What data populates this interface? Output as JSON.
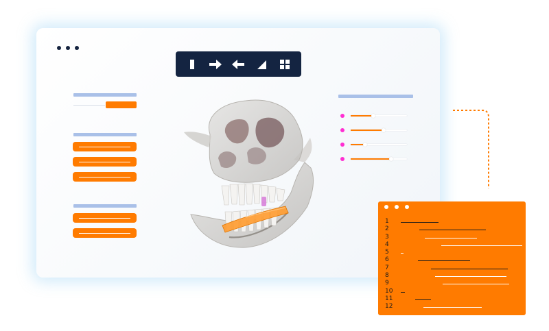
{
  "app": {
    "main_window": {
      "toolbar": {
        "tools": [
          {
            "id": "tool-select",
            "icon": "bar-icon"
          },
          {
            "id": "tool-right",
            "icon": "arrow-right-icon"
          },
          {
            "id": "tool-left",
            "icon": "arrow-left-icon"
          },
          {
            "id": "tool-angle",
            "icon": "triangle-icon"
          },
          {
            "id": "tool-grid",
            "icon": "grid-icon"
          }
        ]
      },
      "right_panel": {
        "sliders": [
          {
            "name": "slider-1",
            "value_fraction": 0.4
          },
          {
            "name": "slider-2",
            "value_fraction": 0.58
          },
          {
            "name": "slider-3",
            "value_fraction": 0.25
          },
          {
            "name": "slider-4",
            "value_fraction": 0.72
          }
        ]
      },
      "viewport": {
        "model": "3D skull model"
      }
    },
    "code_window": {
      "lines": [
        {
          "num": "1",
          "indent": 0.07,
          "length": 0.29,
          "color": "#1b1b1b"
        },
        {
          "num": "2",
          "indent": 0.21,
          "length": 0.51,
          "color": "#1b1b1b"
        },
        {
          "num": "3",
          "indent": 0.25,
          "length": 0.4,
          "color": "#ffffff"
        },
        {
          "num": "4",
          "indent": 0.38,
          "length": 0.62,
          "color": "#ffffff"
        },
        {
          "num": "5",
          "indent": 0.07,
          "length": 0.02,
          "color": "#ffffff"
        },
        {
          "num": "6",
          "indent": 0.2,
          "length": 0.4,
          "color": "#1b1b1b"
        },
        {
          "num": "7",
          "indent": 0.3,
          "length": 0.59,
          "color": "#1b1b1b"
        },
        {
          "num": "8",
          "indent": 0.33,
          "length": 0.55,
          "color": "#ffffff"
        },
        {
          "num": "9",
          "indent": 0.39,
          "length": 0.51,
          "color": "#ffffff"
        },
        {
          "num": "10",
          "indent": 0.07,
          "length": 0.03,
          "color": "#1b1b1b"
        },
        {
          "num": "11",
          "indent": 0.18,
          "length": 0.12,
          "color": "#1b1b1b"
        },
        {
          "num": "12",
          "indent": 0.24,
          "length": 0.45,
          "color": "#ffffff"
        }
      ]
    },
    "colors": {
      "accent": "#ff7b00",
      "navy": "#142441",
      "panel_header": "#a9c0e8",
      "slider_dot": "#ff2fd2"
    }
  }
}
